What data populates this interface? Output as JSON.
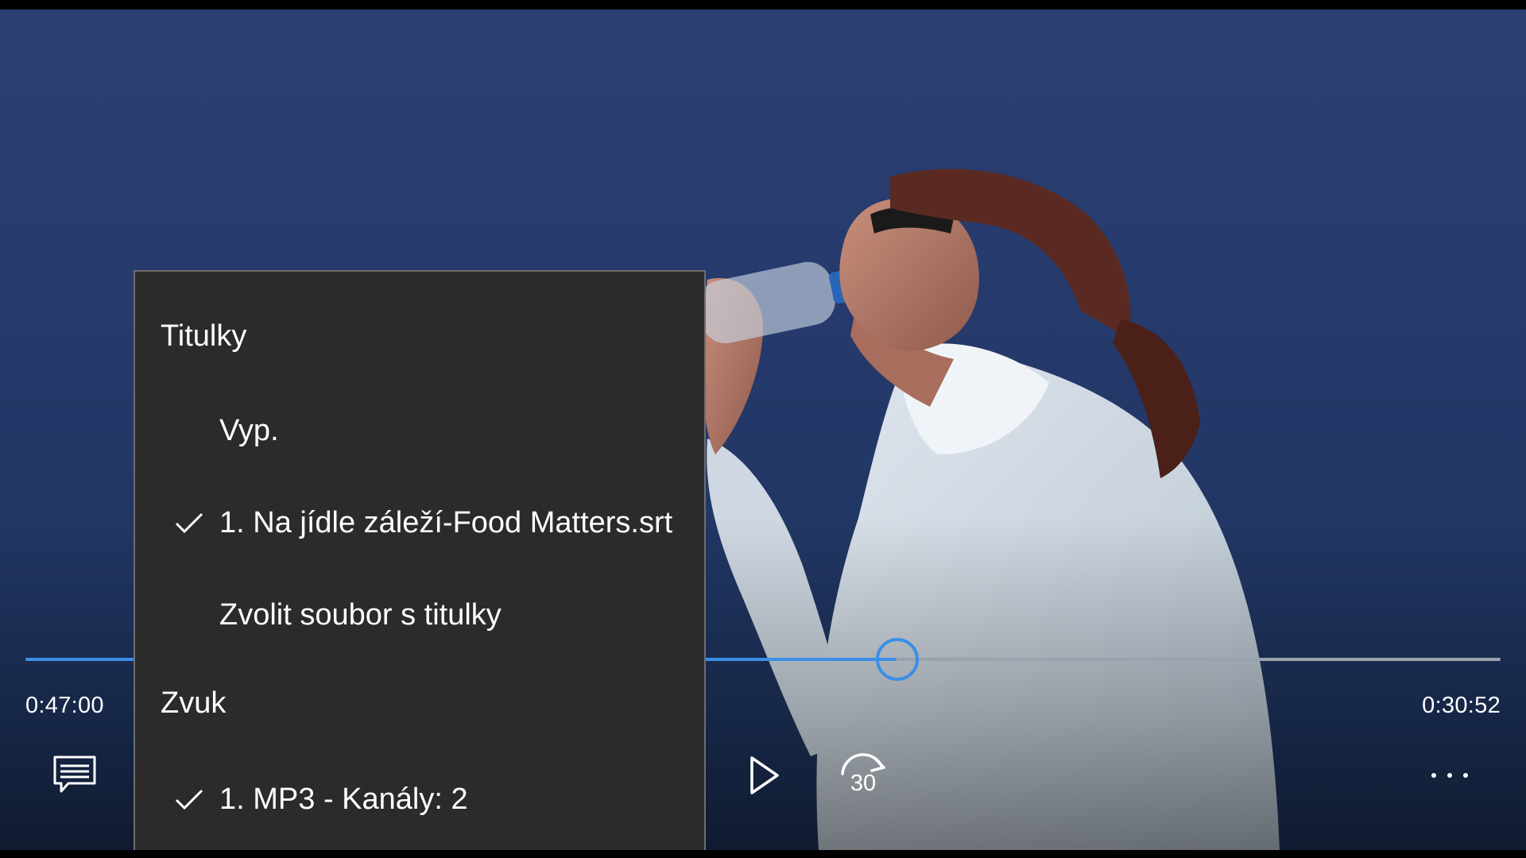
{
  "player": {
    "time_elapsed": "0:47:00",
    "time_remaining": "0:30:52",
    "progress": 0.5905,
    "accent_color": "#3a8ee6",
    "skip_forward_seconds": "30"
  },
  "controls": {
    "subtitles_icon": "captions-icon",
    "play_icon": "play-icon",
    "skip_icon": "skip-forward-30-icon",
    "more_icon": "more-ellipsis-icon"
  },
  "menu": {
    "subtitles_header": "Titulky",
    "subtitle_items": [
      {
        "label": "Vyp.",
        "selected": false
      },
      {
        "label": "1. Na jídle záleží-Food Matters.srt",
        "selected": true
      },
      {
        "label": "Zvolit soubor s titulky",
        "selected": false
      }
    ],
    "audio_header": "Zvuk",
    "audio_items": [
      {
        "label": "1. MP3 - Kanály: 2",
        "selected": true
      }
    ]
  }
}
